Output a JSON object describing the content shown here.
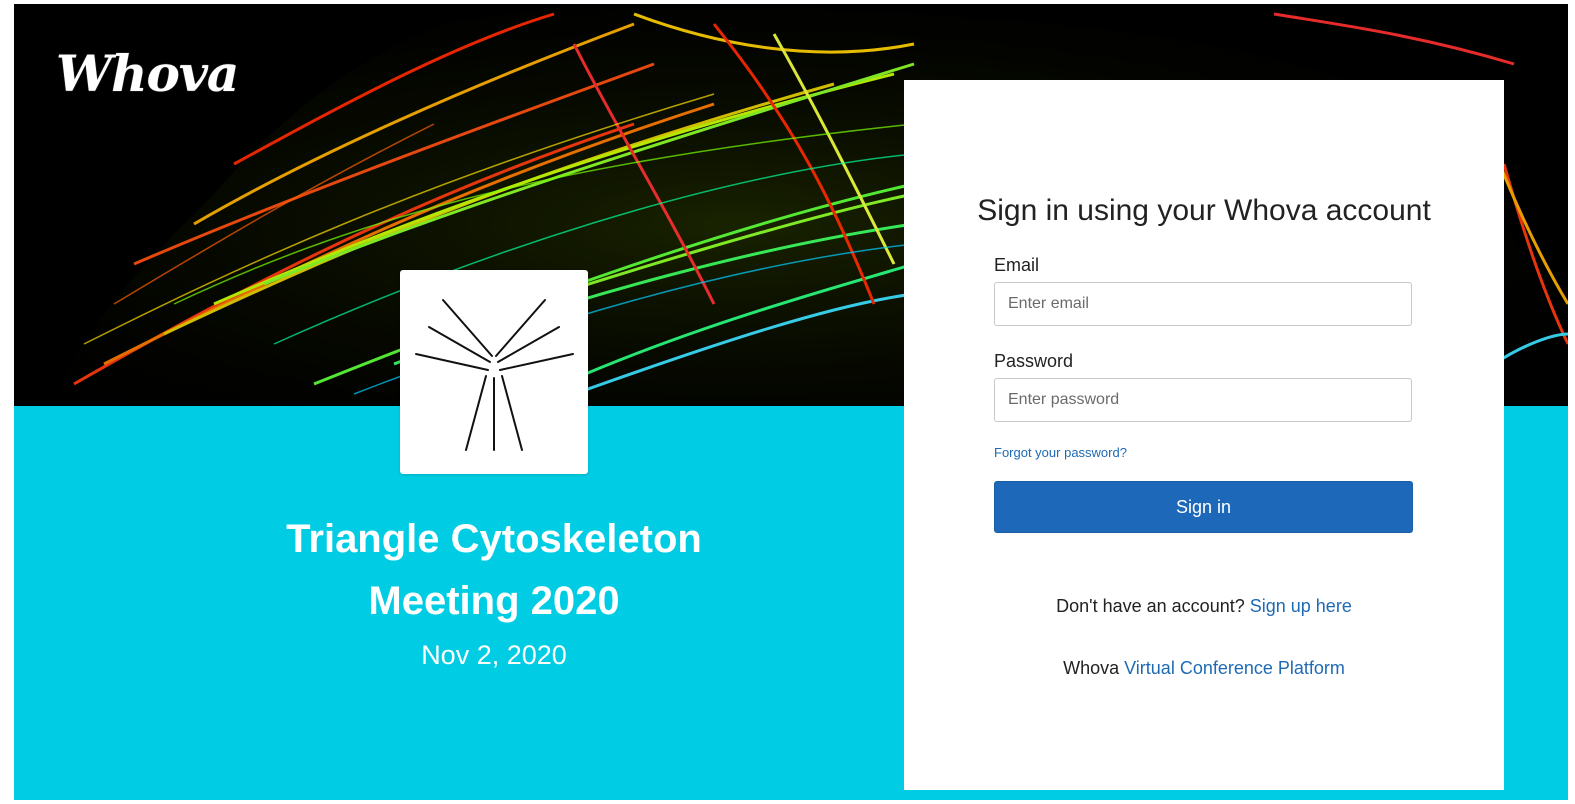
{
  "brand": {
    "logo_text": "Whova"
  },
  "event": {
    "title_line1": "Triangle Cytoskeleton",
    "title_line2": "Meeting 2020",
    "date": "Nov 2, 2020",
    "logo_icon": "radiating-lines-icon"
  },
  "login": {
    "heading": "Sign in using your Whova account",
    "email_label": "Email",
    "email_placeholder": "Enter email",
    "email_value": "",
    "password_label": "Password",
    "password_placeholder": "Enter password",
    "password_value": "",
    "forgot_link": "Forgot your password?",
    "signin_button": "Sign in",
    "no_account_text": "Don't have an account?",
    "signup_link": "Sign up here",
    "platform_prefix": "Whova",
    "platform_link": "Virtual Conference Platform"
  },
  "colors": {
    "accent_cyan": "#00cde3",
    "button_blue": "#1d68b8",
    "link_blue": "#1e6ab5"
  }
}
